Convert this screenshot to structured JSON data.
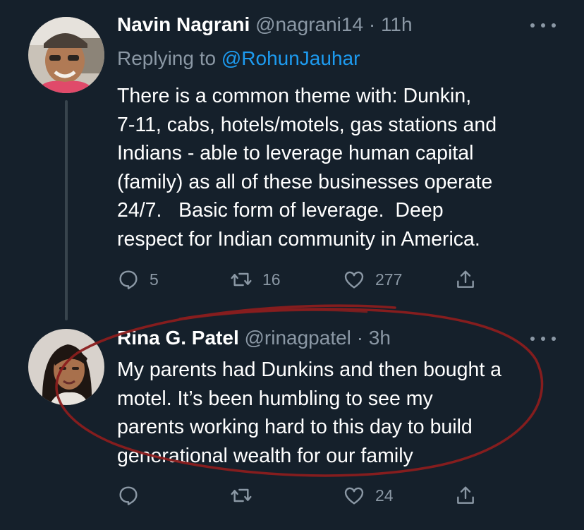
{
  "tweets": [
    {
      "author_name": "Navin Nagrani",
      "handle": "@nagrani14",
      "separator": "·",
      "time": "11h",
      "replying_to_prefix": "Replying to ",
      "replying_to_handle": "@RohunJauhar",
      "text_lines": [
        "There is a common theme with: Dunkin,",
        "7-11, cabs, hotels/motels, gas stations and",
        "Indians - able to leverage human capital",
        "(family) as all of these businesses operate",
        "24/7.   Basic form of leverage.  Deep",
        "respect for Indian community in America."
      ],
      "replies": "5",
      "retweets": "16",
      "likes": "277",
      "avatar_icon": "person-photo"
    },
    {
      "author_name": "Rina G. Patel",
      "handle": "@rinagpatel",
      "separator": "·",
      "time": "3h",
      "text_lines": [
        "My parents had Dunkins and then bought a",
        "motel. It’s been humbling to see my",
        "parents working hard to this day to build",
        "generational wealth for our family"
      ],
      "replies": "",
      "retweets": "",
      "likes": "24",
      "avatar_icon": "person-photo"
    }
  ],
  "colors": {
    "background": "#15202b",
    "text": "#ffffff",
    "muted": "#8b98a5",
    "link": "#1d9bf0",
    "annotation": "#8b1e1e"
  },
  "icons": [
    "reply-icon",
    "retweet-icon",
    "like-icon",
    "share-icon",
    "more-icon"
  ]
}
